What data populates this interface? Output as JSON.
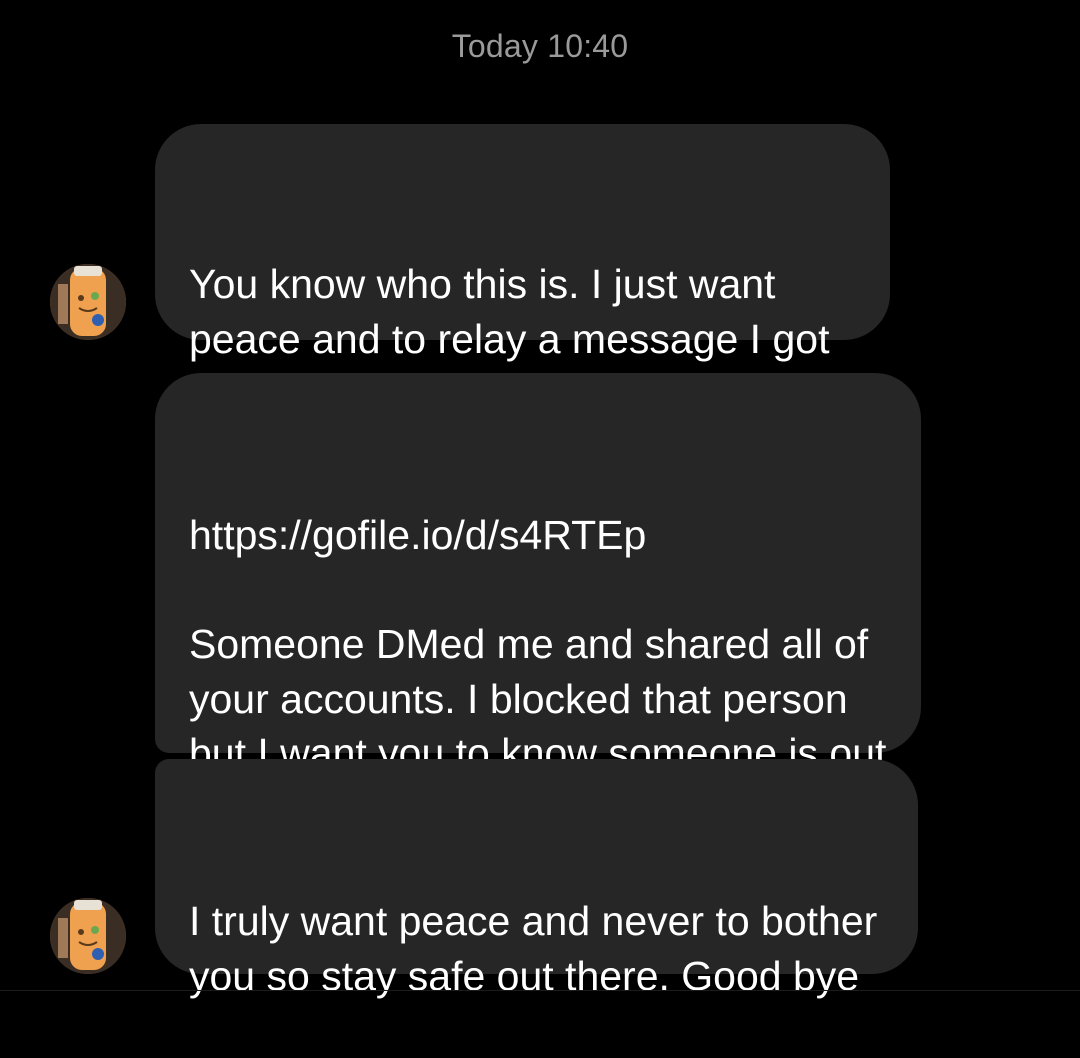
{
  "conversation": {
    "timestamp": "Today 10:40",
    "messages": [
      {
        "text": "You know who this is. I just want peace and to relay a message I got on Twitter"
      },
      {
        "text": "https://gofile.io/d/s4RTEp\n\nSomeone DMed me and shared all of your accounts. I blocked that person but I want you to know someone is out to get you"
      },
      {
        "text": "I truly want peace and never to bother you so stay safe out there. Good bye"
      }
    ]
  },
  "colors": {
    "background": "#000000",
    "bubble": "#262626",
    "timestamp": "#9a9a9a",
    "text": "#ffffff"
  },
  "icons": {
    "avatar": "sender-avatar-icon"
  }
}
